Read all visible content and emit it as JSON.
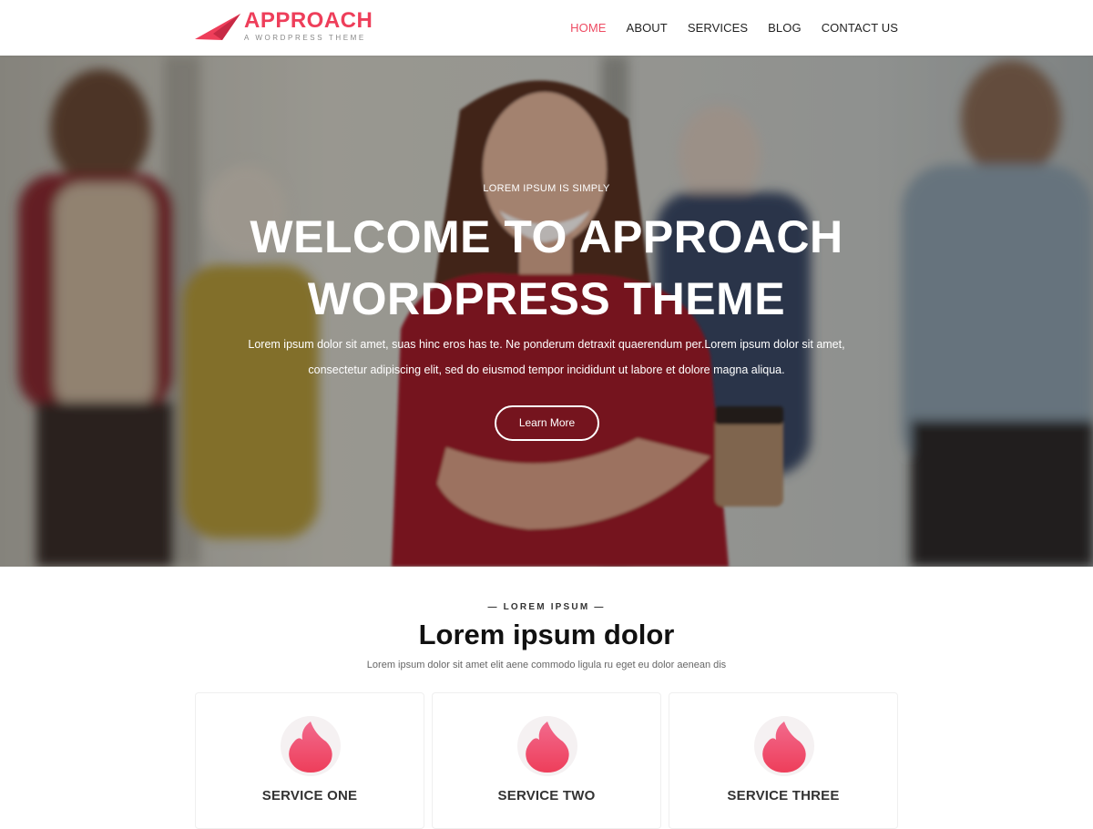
{
  "header": {
    "logo_text": "APPROACH",
    "logo_tagline": "A WORDPRESS THEME",
    "nav": [
      {
        "label": "HOME",
        "active": true
      },
      {
        "label": "ABOUT",
        "active": false
      },
      {
        "label": "SERVICES",
        "active": false
      },
      {
        "label": "BLOG",
        "active": false
      },
      {
        "label": "CONTACT US",
        "active": false
      }
    ]
  },
  "hero": {
    "kicker": "LOREM IPSUM IS SIMPLY",
    "title": "WELCOME TO APPROACH WORDPRESS THEME",
    "text": "Lorem ipsum dolor sit amet, suas hinc eros has te. Ne ponderum detraxit quaerendum per.Lorem ipsum dolor sit amet, consectetur adipiscing elit, sed do eiusmod tempor incididunt ut labore et dolore magna aliqua.",
    "button_label": "Learn More"
  },
  "services": {
    "kicker": "— LOREM IPSUM —",
    "title": "Lorem ipsum dolor",
    "subtitle": "Lorem ipsum dolor sit amet elit aene commodo ligula ru eget eu dolor aenean dis",
    "items": [
      {
        "title": "SERVICE ONE",
        "icon": "flame-icon"
      },
      {
        "title": "SERVICE TWO",
        "icon": "flame-icon"
      },
      {
        "title": "SERVICE THREE",
        "icon": "flame-icon"
      }
    ]
  },
  "colors": {
    "accent": "#ee3e5a",
    "active_nav": "#ee4c63",
    "hero_overlay": "#000000"
  }
}
